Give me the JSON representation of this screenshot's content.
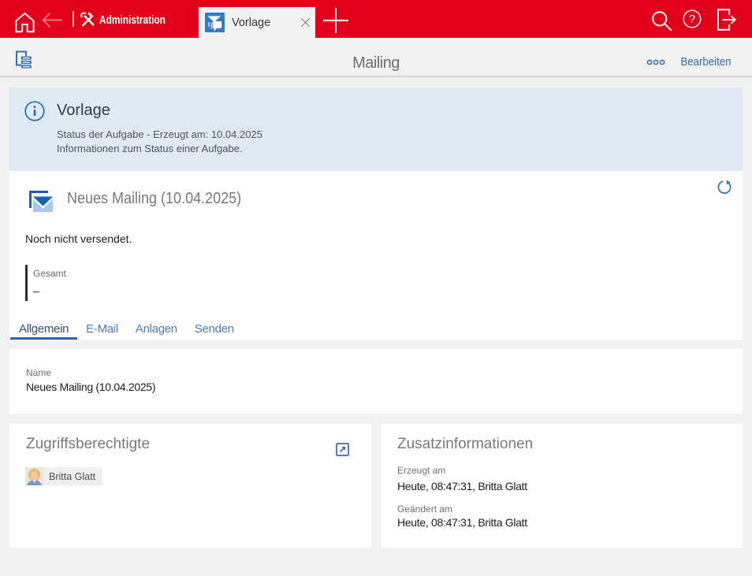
{
  "colors": {
    "brand_red": "#e2001a",
    "accent_blue": "#2e6fb5",
    "banner_blue": "#dfe9f4",
    "page_gray": "#f2f2f2"
  },
  "topbar": {
    "app_label": "Administration",
    "tab": {
      "label": "Vorlage"
    }
  },
  "toolbar": {
    "title": "Mailing",
    "edit_label": "Bearbeiten"
  },
  "banner": {
    "title": "Vorlage",
    "line1": "Status der Aufgabe - Erzeugt am: 10.04.2025",
    "line2": "Informationen zum Status einer Aufgabe."
  },
  "record": {
    "title": "Neues Mailing (10.04.2025)",
    "status": "Noch nicht versendet.",
    "stat": {
      "label": "Gesamt",
      "value": "–"
    },
    "tabs": [
      {
        "label": "Allgemein",
        "active": true
      },
      {
        "label": "E-Mail",
        "active": false
      },
      {
        "label": "Anlagen",
        "active": false
      },
      {
        "label": "Senden",
        "active": false
      }
    ]
  },
  "name_card": {
    "label": "Name",
    "value": "Neues Mailing (10.04.2025)"
  },
  "access_card": {
    "title": "Zugriffsberechtigte",
    "chip_label": "Britta Glatt"
  },
  "info_card": {
    "title": "Zusatzinformationen",
    "fields": [
      {
        "label": "Erzeugt am",
        "value": "Heute, 08:47:31, Britta Glatt"
      },
      {
        "label": "Geändert am",
        "value": "Heute, 08:47:31, Britta Glatt"
      }
    ]
  }
}
